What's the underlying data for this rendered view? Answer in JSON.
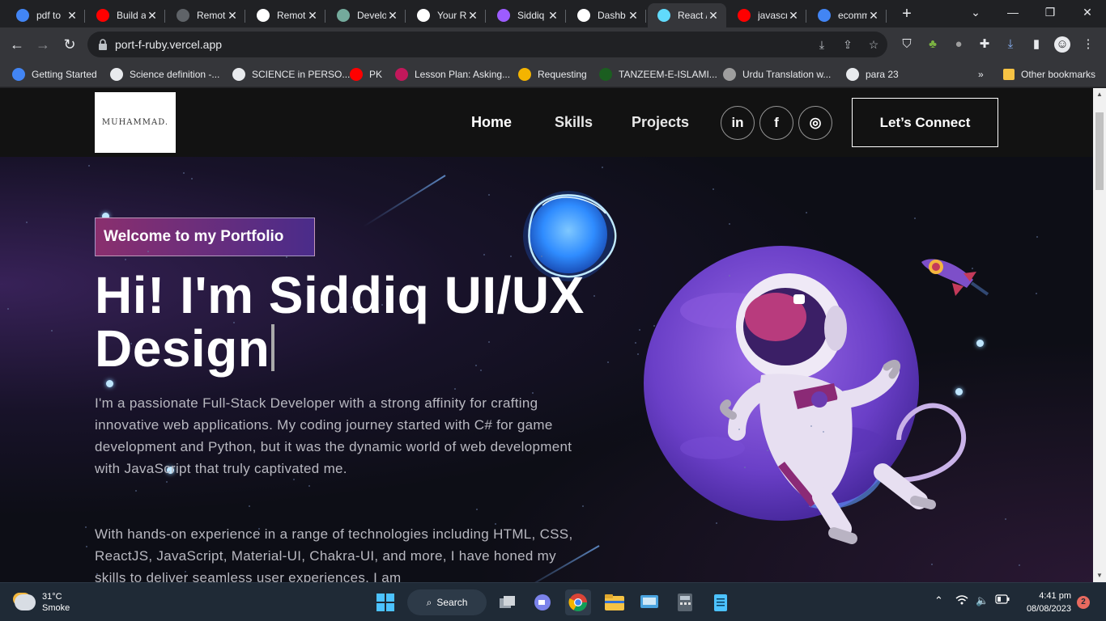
{
  "browser": {
    "tabs": [
      {
        "title": "pdf to",
        "icon": "google-icon",
        "color": "#4285f4"
      },
      {
        "title": "Build a",
        "icon": "youtube-icon",
        "color": "#ff0000"
      },
      {
        "title": "Remot",
        "icon": "remote-icon",
        "color": "#5f6368"
      },
      {
        "title": "Remot",
        "icon": "grid-icon",
        "color": "#ffffff"
      },
      {
        "title": "Develo",
        "icon": "chatgpt-icon",
        "color": "#74aa9c"
      },
      {
        "title": "Your R",
        "icon": "github-icon",
        "color": "#ffffff"
      },
      {
        "title": "Siddiq",
        "icon": "vite-icon",
        "color": "#9d5cff"
      },
      {
        "title": "Dashb",
        "icon": "vercel-icon",
        "color": "#ffffff"
      },
      {
        "title": "React /",
        "icon": "react-icon",
        "color": "#61dafb"
      },
      {
        "title": "javascr",
        "icon": "youtube-icon",
        "color": "#ff0000"
      },
      {
        "title": "ecomm",
        "icon": "google-icon",
        "color": "#4285f4"
      }
    ],
    "url": "port-f-ruby.vercel.app",
    "bookmarks": [
      {
        "label": "Getting Started",
        "icon": "chrome-icon",
        "color": "#4285f4"
      },
      {
        "label": "Science definition -...",
        "icon": "globe-icon",
        "color": "#e8eaed"
      },
      {
        "label": "SCIENCE in PERSO...",
        "icon": "globe-icon",
        "color": "#e8eaed"
      },
      {
        "label": "PK",
        "icon": "youtube-icon",
        "color": "#ff0000"
      },
      {
        "label": "Lesson Plan: Asking...",
        "icon": "lesson-icon",
        "color": "#c2185b"
      },
      {
        "label": "Requesting",
        "icon": "g-icon",
        "color": "#f4b400"
      },
      {
        "label": "TANZEEM-E-ISLAMI...",
        "icon": "flag-icon",
        "color": "#1b5e20"
      },
      {
        "label": "Urdu Translation w...",
        "icon": "book-icon",
        "color": "#9e9e9e"
      },
      {
        "label": "para 23",
        "icon": "globe-icon",
        "color": "#e8eaed"
      }
    ],
    "bookmarks_overflow": "»",
    "other_bookmarks": "Other bookmarks"
  },
  "site": {
    "logo_text": "MUHAMMAD.",
    "nav": {
      "home": "Home",
      "skills": "Skills",
      "projects": "Projects"
    },
    "socials": [
      "in",
      "f",
      "◎"
    ],
    "connect": "Let’s Connect",
    "tagline": "Welcome to my Portfolio",
    "headline": "Hi! I'm Siddiq UI/UX Design",
    "paragraph1": "I'm a passionate Full-Stack Developer with a strong affinity for crafting innovative web applications. My coding journey started with C# for game development and Python, but it was the dynamic world of web development with JavaScript that truly captivated me.",
    "paragraph2": "With hands-on experience in a range of technologies including HTML, CSS, ReactJS, JavaScript, Material-UI, Chakra-UI, and more, I have honed my skills to deliver seamless user experiences. I am"
  },
  "taskbar": {
    "weather_temp": "31°C",
    "weather_desc": "Smoke",
    "search_label": "Search",
    "time": "4:41 pm",
    "date": "08/08/2023",
    "notifications": "2"
  }
}
